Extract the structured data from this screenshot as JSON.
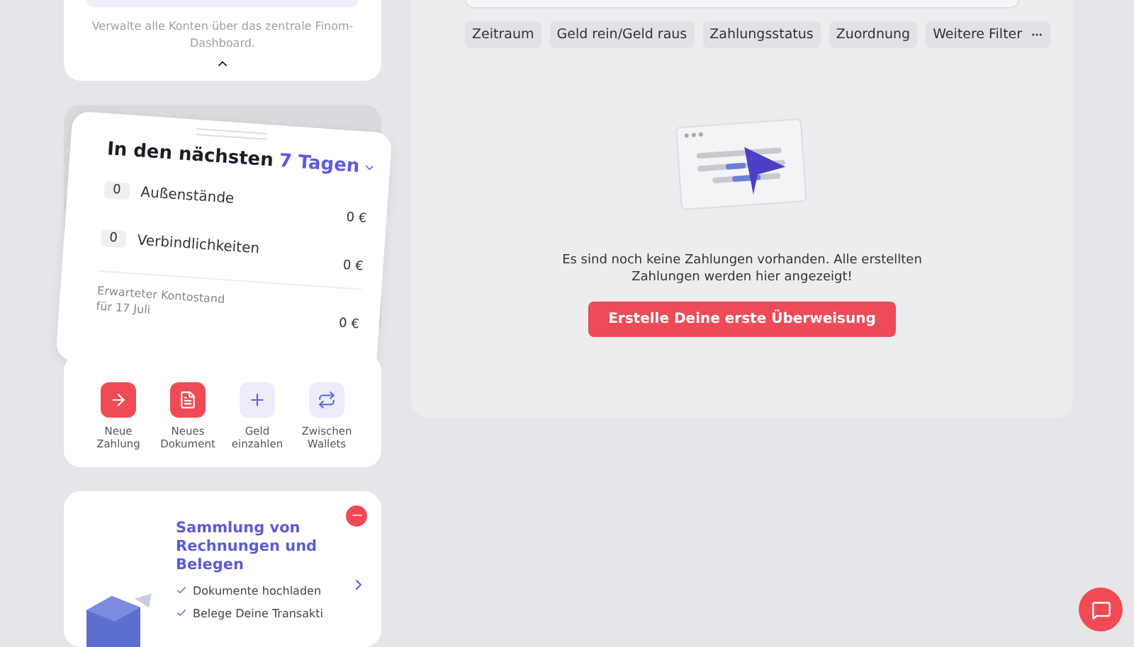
{
  "accounts_card": {
    "note": "Verwalte alle Konten über das zentrale Finom-Dashboard."
  },
  "forecast": {
    "title": "In den nächsten",
    "period": "7 Tagen",
    "rows": [
      {
        "count": "0",
        "label": "Außenstände",
        "amount": "0 €"
      },
      {
        "count": "0",
        "label": "Verbindlichkeiten",
        "amount": "0 €"
      }
    ],
    "expected_label": "Erwarteter Kontostand für 17 Juli",
    "expected_amount": "0 €"
  },
  "quick_actions": [
    {
      "label": "Neue Zahlung",
      "kind": "payment",
      "primary": true
    },
    {
      "label": "Neues Dokument",
      "kind": "document",
      "primary": true
    },
    {
      "label": "Geld einzahlen",
      "kind": "deposit",
      "primary": false
    },
    {
      "label": "Zwischen Wallets",
      "kind": "transfer",
      "primary": false
    }
  ],
  "promo": {
    "title": "Sammlung von Rechnungen und Belegen",
    "items": [
      "Dokumente hochladen",
      "Belege Deine Transakti"
    ]
  },
  "filters": [
    "Zeitraum",
    "Geld rein/Geld raus",
    "Zahlungsstatus",
    "Zuordnung",
    "Weitere Filter"
  ],
  "empty_state": {
    "message": "Es sind noch keine Zahlungen vorhanden. Alle erstellten Zahlungen werden hier angezeigt!",
    "button": "Erstelle Deine erste Überweisung"
  }
}
